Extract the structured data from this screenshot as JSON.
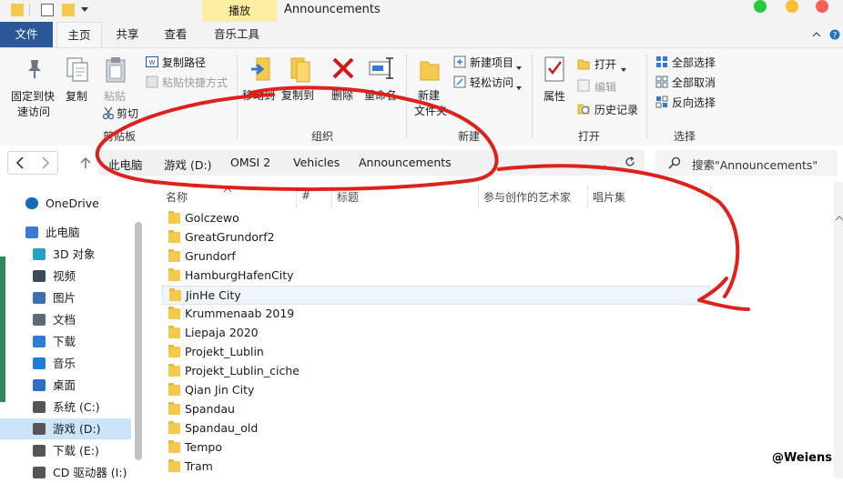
{
  "window": {
    "title": "Announcements",
    "context_tab": "播放",
    "mac_colors": [
      "#28c840",
      "#febc2e",
      "#ff5f57"
    ]
  },
  "tabs": [
    {
      "label": "文件",
      "active": false,
      "color": "#2b5797"
    },
    {
      "label": "主页",
      "active": true
    },
    {
      "label": "共享"
    },
    {
      "label": "查看"
    },
    {
      "label": "音乐工具"
    }
  ],
  "ribbon": {
    "clipboard": {
      "pin": "固定到快速访问",
      "pin_line1": "固定到快",
      "pin_line2": "速访问",
      "copy": "复制",
      "paste": "粘贴",
      "copy_path": "复制路径",
      "paste_shortcut": "粘贴快捷方式",
      "cut": "剪切",
      "group": "剪贴板"
    },
    "organize": {
      "move_to": "移动到",
      "copy_to": "复制到",
      "delete": "删除",
      "rename": "重命名",
      "group": "组织"
    },
    "new": {
      "new_folder_line1": "新建",
      "new_folder_line2": "文件夹",
      "new_item": "新建项目",
      "easy_access": "轻松访问",
      "group": "新建"
    },
    "open": {
      "properties": "属性",
      "open": "打开",
      "edit": "编辑",
      "history": "历史记录",
      "group": "打开"
    },
    "select": {
      "select_all": "全部选择",
      "select_none": "全部取消",
      "invert": "反向选择",
      "group": "选择"
    }
  },
  "address": {
    "crumbs": [
      "此电脑",
      "游戏 (D:)",
      "OMSI 2",
      "Vehicles",
      "Announcements"
    ],
    "search_placeholder": "搜索\"Announcements\""
  },
  "nav": [
    {
      "label": "OneDrive",
      "icon": "cloud-icon",
      "color": "#0f6cbd"
    },
    {
      "label": "此电脑",
      "icon": "computer-icon",
      "color": "#3a7bd5"
    },
    {
      "label": "3D 对象",
      "icon": "cube-icon",
      "color": "#27a0c8"
    },
    {
      "label": "视频",
      "icon": "film-icon",
      "color": "#3d4a5a"
    },
    {
      "label": "图片",
      "icon": "picture-icon",
      "color": "#3d6fb0"
    },
    {
      "label": "文档",
      "icon": "document-icon",
      "color": "#5b6b7d"
    },
    {
      "label": "下载",
      "icon": "download-arrow-icon",
      "color": "#2f7bd6"
    },
    {
      "label": "音乐",
      "icon": "music-note-icon",
      "color": "#1f7bd6"
    },
    {
      "label": "桌面",
      "icon": "desktop-icon",
      "color": "#2f6fc2"
    },
    {
      "label": "系统 (C:)",
      "icon": "drive-icon",
      "color": "#555"
    },
    {
      "label": "游戏 (D:)",
      "icon": "drive-icon",
      "color": "#555",
      "selected": true
    },
    {
      "label": "下载 (E:)",
      "icon": "drive-icon",
      "color": "#555"
    },
    {
      "label": "CD 驱动器 (I:)",
      "icon": "cd-drive-icon",
      "color": "#555"
    }
  ],
  "columns": [
    "名称",
    "#",
    "标题",
    "参与创作的艺术家",
    "唱片集"
  ],
  "files": [
    "Golczewo",
    "GreatGrundorf2",
    "Grundorf",
    "HamburgHafenCity",
    "JinHe City",
    "Krummenaab 2019",
    "Liepaja 2020",
    "Projekt_Lublin",
    "Projekt_Lublin_ciche",
    "Qian Jin City",
    "Spandau",
    "Spandau_old",
    "Tempo",
    "Tram"
  ],
  "selected_file": "JinHe City",
  "annotation_color": "#e0201b",
  "watermark": "@Weiens"
}
